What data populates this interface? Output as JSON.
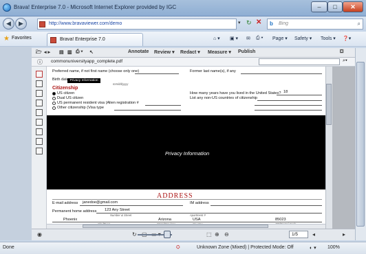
{
  "window": {
    "title": "Brava! Enterprise 7.0 - Microsoft Internet Explorer provided by IGC",
    "min_label": "–",
    "max_label": "□",
    "close_label": "✕"
  },
  "address": {
    "url": "http://www.bravaviewer.com/demo",
    "search_placeholder": "Bing",
    "search_brand": "b"
  },
  "favorites": {
    "label": "Favorites",
    "tab_label": "Brava! Enterprise 7.0",
    "commands": [
      "Page ▾",
      "Safety ▾",
      "Tools ▾"
    ]
  },
  "viewer": {
    "menus": [
      "Annotate",
      "Review ▾",
      "Redact ▾",
      "Measure ▾",
      "Publish"
    ],
    "filename": "commonuniversityapp_complete.pdf",
    "page_select": "1/5"
  },
  "form": {
    "preferred_name": "Preferred name, if not first name (choose only one)",
    "former_names": "Former last name(s), if any",
    "birth_date": "Birth date",
    "birth_redact": "Privacy Information",
    "date_hint": "mm/dd/yyyy",
    "citizenship_heading": "Citizenship",
    "options": [
      "US citizen",
      "Dual US citizen",
      "US permanent resident visa (Alien registration #",
      "Other citizenship (Visa type"
    ],
    "years_question": "How many years have you lived in the United States?",
    "years_value": "18",
    "countries_question": "List any non-US countries of citizenship",
    "redact_label": "Privacy Information",
    "address_heading": "ADDRESS",
    "email_label": "E-mail address",
    "email_value": "janedoe@gmail.com",
    "im_label": "IM address",
    "perm_address_label": "Permanent home address",
    "street_value": "123 Any Street",
    "street_hint": "Number & Street",
    "apt_hint": "Apartment #",
    "city_value": "Phoenix",
    "state_value": "Arizona",
    "country_value": "USA",
    "zip_value": "85023",
    "city_hint": "City/Town",
    "state_hint": "State/Province",
    "country_hint": "Country",
    "zip_hint": "ZIP/Postal Code"
  },
  "status": {
    "left": "Done",
    "zone": "Unknown Zone (Mixed) | Protected Mode: Off",
    "zoom": "100%"
  }
}
